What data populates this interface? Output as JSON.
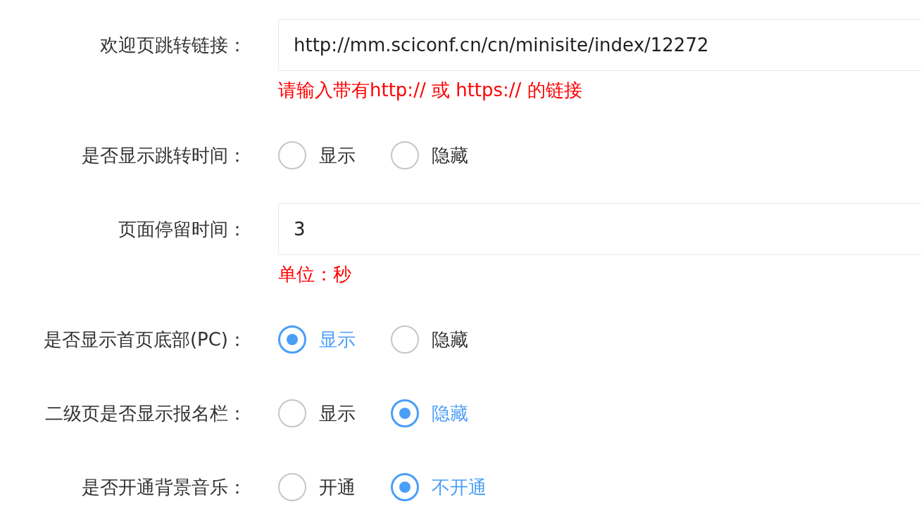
{
  "form": {
    "fields": [
      {
        "kind": "text",
        "label": "欢迎页跳转链接：",
        "value": "http://mm.sciconf.cn/cn/minisite/index/12272",
        "note": "请输入带有http:// 或 https:// 的链接"
      },
      {
        "kind": "radio",
        "label": "是否显示跳转时间：",
        "options": [
          {
            "label": "显示",
            "selected": false
          },
          {
            "label": "隐藏",
            "selected": false
          }
        ]
      },
      {
        "kind": "text",
        "label": "页面停留时间：",
        "value": "3",
        "note": "单位：秒"
      },
      {
        "kind": "radio",
        "label": "是否显示首页底部(PC)：",
        "options": [
          {
            "label": "显示",
            "selected": true
          },
          {
            "label": "隐藏",
            "selected": false
          }
        ]
      },
      {
        "kind": "radio",
        "label": "二级页是否显示报名栏：",
        "options": [
          {
            "label": "显示",
            "selected": false
          },
          {
            "label": "隐藏",
            "selected": true
          }
        ]
      },
      {
        "kind": "radio",
        "label": "是否开通背景音乐：",
        "options": [
          {
            "label": "开通",
            "selected": false
          },
          {
            "label": "不开通",
            "selected": true
          }
        ]
      }
    ]
  }
}
